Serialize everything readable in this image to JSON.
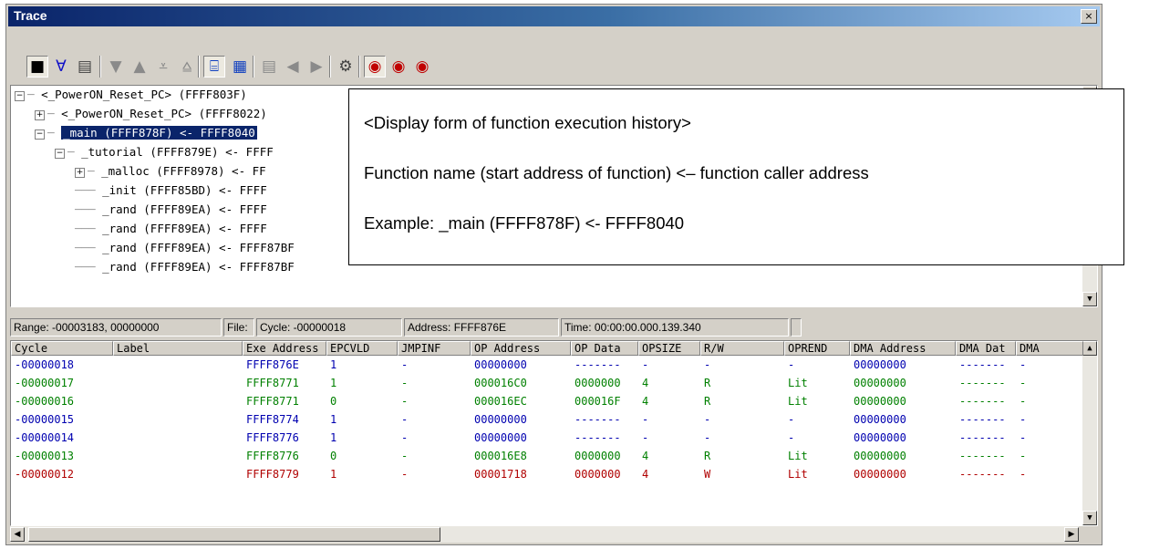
{
  "window": {
    "title": "Trace",
    "close_label": "×"
  },
  "colors": {
    "blue": "#0000b0",
    "green": "#008000",
    "red": "#b00000",
    "title": "#0a246a"
  },
  "toolbar": {
    "buttons": [
      {
        "name": "record-icon",
        "glyph": "■",
        "color": "#000000",
        "pressed": true
      },
      {
        "name": "filter-icon",
        "glyph": "∀",
        "color": "#1010c8",
        "pressed": false
      },
      {
        "name": "document-icon",
        "glyph": "▤",
        "color": "#404040",
        "pressed": false
      },
      {
        "name": "find-next-icon",
        "glyph": "▼",
        "color": "#8a8a8a",
        "pressed": false
      },
      {
        "name": "find-prev-icon",
        "glyph": "▲",
        "color": "#8a8a8a",
        "pressed": false
      },
      {
        "name": "find-bottom-icon",
        "glyph": "⩡",
        "color": "#8a8a8a",
        "pressed": false
      },
      {
        "name": "find-top-icon",
        "glyph": "⩠",
        "color": "#8a8a8a",
        "pressed": false
      },
      {
        "name": "function-tree-icon",
        "glyph": "⌸",
        "color": "#1040c0",
        "pressed": true
      },
      {
        "name": "function-list-icon",
        "glyph": "▦",
        "color": "#1040c0",
        "pressed": false
      },
      {
        "name": "source-view-icon",
        "glyph": "▤",
        "color": "#8a8a8a",
        "pressed": false
      },
      {
        "name": "step-back-icon",
        "glyph": "◀",
        "color": "#8a8a8a",
        "pressed": false
      },
      {
        "name": "step-forward-icon",
        "glyph": "▶",
        "color": "#8a8a8a",
        "pressed": false
      },
      {
        "name": "settings-icon",
        "glyph": "⚙",
        "color": "#404040",
        "pressed": false
      },
      {
        "name": "trace-start-icon",
        "glyph": "◉",
        "color": "#c00000",
        "pressed": true
      },
      {
        "name": "trace-stop-icon",
        "glyph": "◉",
        "color": "#c00000",
        "pressed": false
      },
      {
        "name": "trace-clear-icon",
        "glyph": "◉",
        "color": "#c00000",
        "pressed": false
      }
    ]
  },
  "tree": {
    "nodes": [
      {
        "text": "<_PowerON_Reset_PC> (FFFF803F)",
        "toggle": "−",
        "level": 0,
        "selected": false
      },
      {
        "text": "<_PowerON_Reset_PC> (FFFF8022)",
        "toggle": "+",
        "level": 1,
        "selected": false
      },
      {
        "text": "_main (FFFF878F) <- FFFF8040",
        "toggle": "−",
        "level": 1,
        "selected": true
      },
      {
        "text": "_tutorial (FFFF879E) <- FFFF",
        "toggle": "−",
        "level": 2,
        "selected": false
      },
      {
        "text": "_malloc (FFFF8978) <- FF",
        "toggle": "+",
        "level": 3,
        "selected": false
      },
      {
        "text": "_init (FFFF85BD) <- FFFF",
        "toggle": "",
        "level": 3,
        "selected": false
      },
      {
        "text": "_rand (FFFF89EA) <- FFFF",
        "toggle": "",
        "level": 3,
        "selected": false
      },
      {
        "text": "_rand (FFFF89EA) <- FFFF",
        "toggle": "",
        "level": 3,
        "selected": false
      },
      {
        "text": "_rand (FFFF89EA) <- FFFF87BF",
        "toggle": "",
        "level": 3,
        "selected": false
      },
      {
        "text": "_rand (FFFF89EA) <- FFFF87BF",
        "toggle": "",
        "level": 3,
        "selected": false
      }
    ]
  },
  "callout": {
    "line1": "<Display form of function execution history>",
    "line2": "Function name (start address of function) <– function caller address",
    "line3": "Example: _main (FFFF878F) <- FFFF8040"
  },
  "status": {
    "range": "Range: -00003183, 00000000",
    "file": "File:",
    "cycle": "Cycle: -00000018",
    "address": "Address: FFFF876E",
    "time": "Time: 00:00:00.000.139.340"
  },
  "grid": {
    "columns": [
      "Cycle",
      "Label",
      "Exe Address",
      "EPCVLD",
      "JMPINF",
      "OP Address",
      "OP Data",
      "OPSIZE",
      "R/W",
      "OPREND",
      "DMA Address",
      "DMA Dat",
      "DMA"
    ],
    "rows": [
      {
        "color": "blue",
        "cells": [
          "-00000018",
          "",
          "FFFF876E",
          "1",
          "-",
          "00000000",
          "-------",
          "-",
          "-",
          "-",
          "00000000",
          "-------",
          "-"
        ]
      },
      {
        "color": "green",
        "cells": [
          "-00000017",
          "",
          "FFFF8771",
          "1",
          "-",
          "000016C0",
          "0000000",
          "4",
          "R",
          "Lit",
          "00000000",
          "-------",
          "-"
        ]
      },
      {
        "color": "green",
        "cells": [
          "-00000016",
          "",
          "FFFF8771",
          "0",
          "-",
          "000016EC",
          "000016F",
          "4",
          "R",
          "Lit",
          "00000000",
          "-------",
          "-"
        ]
      },
      {
        "color": "blue",
        "cells": [
          "-00000015",
          "",
          "FFFF8774",
          "1",
          "-",
          "00000000",
          "-------",
          "-",
          "-",
          "-",
          "00000000",
          "-------",
          "-"
        ]
      },
      {
        "color": "blue",
        "cells": [
          "-00000014",
          "",
          "FFFF8776",
          "1",
          "-",
          "00000000",
          "-------",
          "-",
          "-",
          "-",
          "00000000",
          "-------",
          "-"
        ]
      },
      {
        "color": "green",
        "cells": [
          "-00000013",
          "",
          "FFFF8776",
          "0",
          "-",
          "000016E8",
          "0000000",
          "4",
          "R",
          "Lit",
          "00000000",
          "-------",
          "-"
        ]
      },
      {
        "color": "red",
        "cells": [
          "-00000012",
          "",
          "FFFF8779",
          "1",
          "-",
          "00001718",
          "0000000",
          "4",
          "W",
          "Lit",
          "00000000",
          "-------",
          "-"
        ]
      }
    ]
  },
  "scroll": {
    "up": "▲",
    "down": "▼",
    "left": "◀",
    "right": "▶"
  }
}
